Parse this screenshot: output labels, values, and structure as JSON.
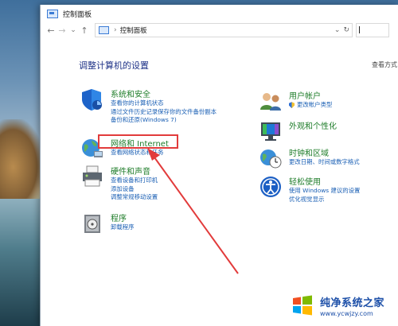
{
  "window": {
    "title": "控制面板"
  },
  "nav": {
    "back": "←",
    "forward": "→",
    "recent": "⌄",
    "up": "↑"
  },
  "address": {
    "separator": "›",
    "path": "控制面板",
    "dropdown": "⌄",
    "refresh": "↻"
  },
  "main": {
    "heading": "调整计算机的设置",
    "view_by": "查看方式"
  },
  "categories_left": [
    {
      "id": "system-security",
      "title": "系统和安全",
      "links": [
        "查看你的计算机状态",
        "通过文件历史记录保存你的文件备份副本",
        "备份和还原(Windows 7)"
      ]
    },
    {
      "id": "network-internet",
      "title": "网络和 Internet",
      "links": [
        "查看网络状态和任务"
      ]
    },
    {
      "id": "hardware-sound",
      "title": "硬件和声音",
      "links": [
        "查看设备和打印机",
        "添加设备",
        "调整常规移动设置"
      ]
    },
    {
      "id": "programs",
      "title": "程序",
      "links": [
        "卸载程序"
      ]
    }
  ],
  "categories_right": [
    {
      "id": "user-accounts",
      "title": "用户帐户",
      "links": [
        "更改帐户类型"
      ]
    },
    {
      "id": "appearance",
      "title": "外观和个性化",
      "links": []
    },
    {
      "id": "clock-region",
      "title": "时钟和区域",
      "links": [
        "更改日期、时间或数字格式"
      ]
    },
    {
      "id": "ease-of-access",
      "title": "轻松使用",
      "links": [
        "使用 Windows 建议的设置",
        "优化视觉显示"
      ]
    }
  ],
  "watermark": {
    "name": "纯净系统之家",
    "url": "www.ycwjzy.com"
  },
  "colors": {
    "category_title": "#1f7d2a",
    "link": "#1a5fb4",
    "heading": "#1e3287",
    "annotation": "#e23b3b"
  }
}
